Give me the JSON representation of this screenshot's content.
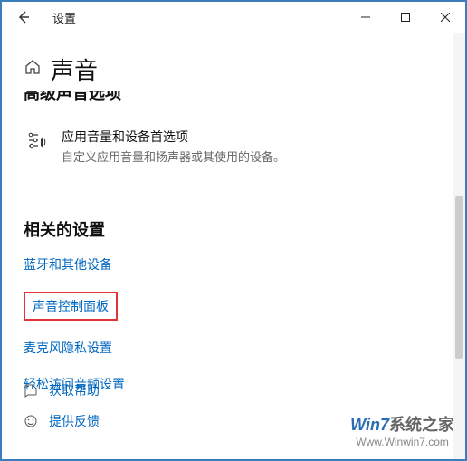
{
  "window": {
    "title": "设置"
  },
  "page": {
    "title": "声音",
    "advanced_heading": "高级声音选项"
  },
  "option": {
    "title": "应用音量和设备首选项",
    "subtitle": "自定义应用音量和扬声器或其使用的设备。"
  },
  "related": {
    "heading": "相关的设置",
    "links": {
      "bluetooth": "蓝牙和其他设备",
      "sound_panel": "声音控制面板",
      "mic_privacy": "麦克风隐私设置",
      "ease_audio": "轻松访问音频设置"
    }
  },
  "footer": {
    "help": "获取帮助",
    "feedback": "提供反馈"
  },
  "watermark": {
    "line1": "Win7系统之家",
    "line2": "Www.Winwin7.com"
  }
}
